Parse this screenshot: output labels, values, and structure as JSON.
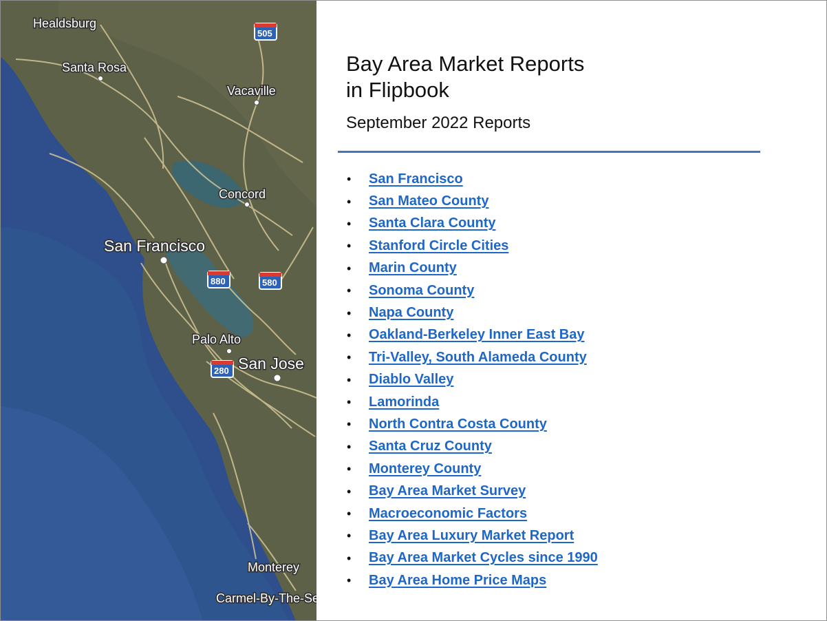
{
  "map": {
    "alt": "Satellite map of the San Francisco Bay Area",
    "colors": {
      "ocean": "#2f4f8c",
      "bay": "#3f6870",
      "land": "#5b6046",
      "road": "#ddd0a0"
    },
    "places": [
      {
        "name": "Healdsburg"
      },
      {
        "name": "Santa Rosa"
      },
      {
        "name": "Vacaville"
      },
      {
        "name": "Concord"
      },
      {
        "name": "San Francisco"
      },
      {
        "name": "Palo Alto"
      },
      {
        "name": "San Jose"
      },
      {
        "name": "Monterey"
      },
      {
        "name": "Carmel-By-The-Sea"
      }
    ],
    "highways": [
      "505",
      "880",
      "580",
      "280"
    ]
  },
  "title": "Bay Area Market Reports in Flipbook",
  "title_line1": "Bay Area Market Reports",
  "title_line2": "in Flipbook",
  "subtitle": "September 2022 Reports",
  "accent_color": "#4472c4",
  "link_color": "#1f67c6",
  "bullet": "•",
  "reports": [
    {
      "label": "San Francisco"
    },
    {
      "label": "San Mateo County"
    },
    {
      "label": "Santa Clara County"
    },
    {
      "label": "Stanford Circle Cities"
    },
    {
      "label": "Marin County"
    },
    {
      "label": "Sonoma County"
    },
    {
      "label": "Napa County"
    },
    {
      "label": "Oakland-Berkeley Inner East Bay"
    },
    {
      "label": "Tri-Valley, South Alameda County"
    },
    {
      "label": "Diablo Valley"
    },
    {
      "label": "Lamorinda"
    },
    {
      "label": "North Contra Costa County"
    },
    {
      "label": "Santa Cruz County"
    },
    {
      "label": "Monterey County"
    },
    {
      "label": "Bay Area Market Survey"
    },
    {
      "label": "Macroeconomic Factors"
    },
    {
      "label": "Bay Area Luxury Market Report"
    },
    {
      "label": "Bay Area Market Cycles since 1990"
    },
    {
      "label": "Bay Area Home Price Maps"
    }
  ]
}
